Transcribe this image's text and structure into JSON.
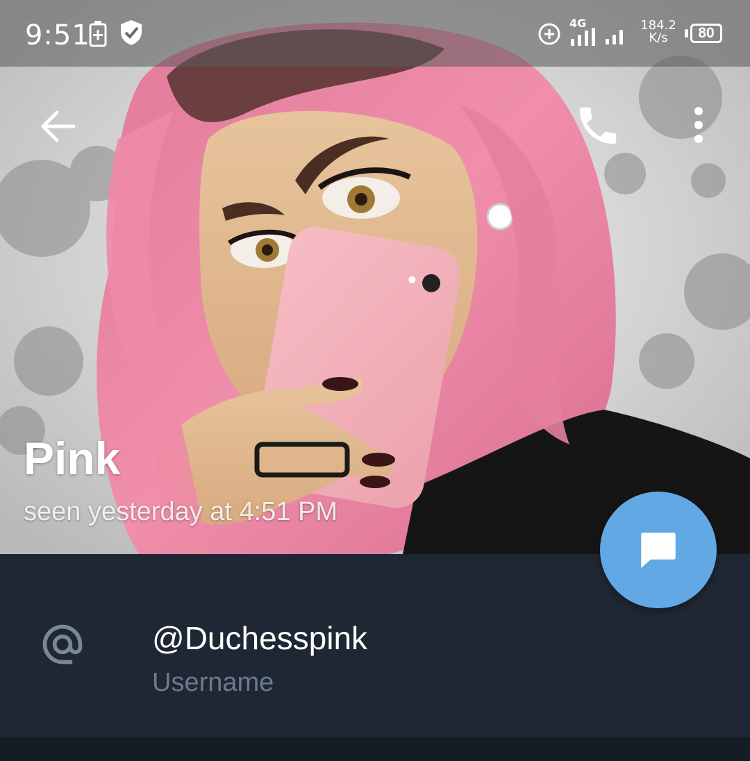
{
  "status_bar": {
    "time": "9:51",
    "network": "4G",
    "speed_value": "184.2",
    "speed_unit": "K/s",
    "battery": "80"
  },
  "toolbar": {
    "back_icon": "arrow-left-icon",
    "call_icon": "phone-icon",
    "menu_icon": "more-vertical-icon"
  },
  "profile": {
    "name": "Pink",
    "last_seen": "seen yesterday at 4:51 PM"
  },
  "info": {
    "username": "@Duchesspink",
    "username_caption": "Username",
    "username_icon": "at-sign-icon"
  },
  "fab": {
    "icon": "chat-bubble-icon"
  },
  "colors": {
    "accent": "#62a8e5",
    "panel_bg": "#1e2733",
    "caption": "#6c7b8c"
  }
}
